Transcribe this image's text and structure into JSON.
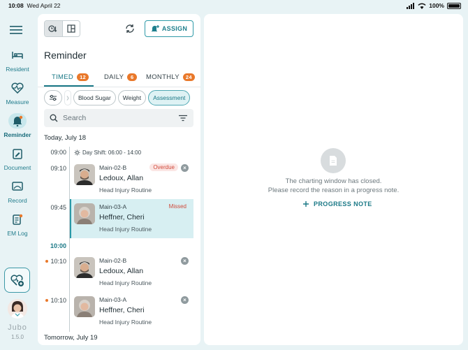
{
  "status_bar": {
    "time": "10:08",
    "date": "Wed April 22",
    "battery": "100%"
  },
  "sidebar": {
    "items": [
      {
        "label": "Resident",
        "icon": "bed-icon"
      },
      {
        "label": "Measure",
        "icon": "heart-pulse-icon"
      },
      {
        "label": "Reminder",
        "icon": "bell-icon",
        "active": true
      },
      {
        "label": "Document",
        "icon": "pen-document-icon"
      },
      {
        "label": "Record",
        "icon": "record-monitor-icon"
      },
      {
        "label": "EM Log",
        "icon": "em-log-icon"
      }
    ],
    "brand": "Jubo",
    "version": "1.5.0"
  },
  "panel": {
    "title": "Reminder",
    "assign_label": "ASSIGN",
    "tabs": [
      {
        "label": "TIMED",
        "count": "12"
      },
      {
        "label": "DAILY",
        "count": "6"
      },
      {
        "label": "MONTHLY",
        "count": "24"
      }
    ],
    "filters": [
      "Blood Sugar",
      "Weight",
      "Assessment"
    ],
    "search_placeholder": "Search",
    "today_label": "Today, July 18",
    "tomorrow_label": "Tomorrow, July 19",
    "shift_time": "09:00",
    "shift_label": "Day Shift: 06:00 - 14:00",
    "hour_marker": "10:00",
    "reminders": [
      {
        "time": "09:10",
        "unit": "Main-02-B",
        "name": "Ledoux, Allan",
        "routine": "Head Injury Routine",
        "status": "Overdue",
        "dot": false
      },
      {
        "time": "09:45",
        "unit": "Main-03-A",
        "name": "Heffner, Cheri",
        "routine": "Head Injury Routine",
        "status": "Missed",
        "dot": false
      },
      {
        "time": "10:10",
        "unit": "Main-02-B",
        "name": "Ledoux, Allan",
        "routine": "Head Injury Routine",
        "status": "",
        "dot": true
      },
      {
        "time": "10:10",
        "unit": "Main-03-A",
        "name": "Heffner, Cheri",
        "routine": "Head Injury Routine",
        "status": "",
        "dot": true
      }
    ]
  },
  "detail": {
    "message_line1": "The charting window has closed.",
    "message_line2": "Please record the reason in a progress note.",
    "progress_note_label": "PROGRESS NOTE"
  },
  "colors": {
    "accent": "#1a7886",
    "badge": "#e9782a",
    "alert": "#d04a3b",
    "highlight": "#d7eff2"
  }
}
